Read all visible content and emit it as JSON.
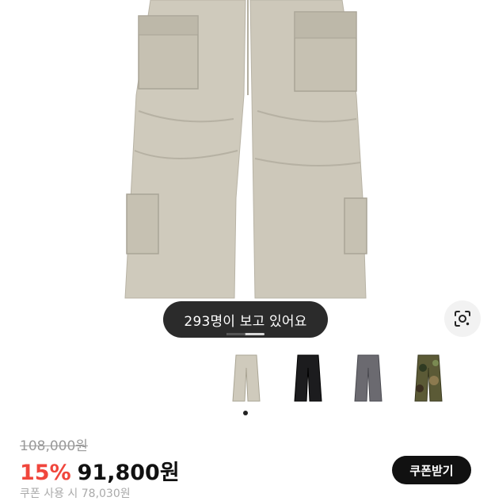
{
  "product": {
    "viewers_text": "293명이 보고 있어요",
    "lens_icon": "google-lens-icon",
    "image_position": 0.5,
    "colors": {
      "beige": "#cfcabc",
      "black": "#1c1c1e",
      "gray": "#6b6a70",
      "camo": "#5b5a36"
    },
    "selected_color_index": 0
  },
  "pricing": {
    "original_price": "108,000원",
    "discount": "15%",
    "price": "91,800원",
    "coupon_button": "쿠폰받기",
    "coupon_note": "쿠폰 사용 시 78,030원"
  },
  "theme": {
    "discount_color": "#f0463c",
    "button_bg": "#111111"
  }
}
